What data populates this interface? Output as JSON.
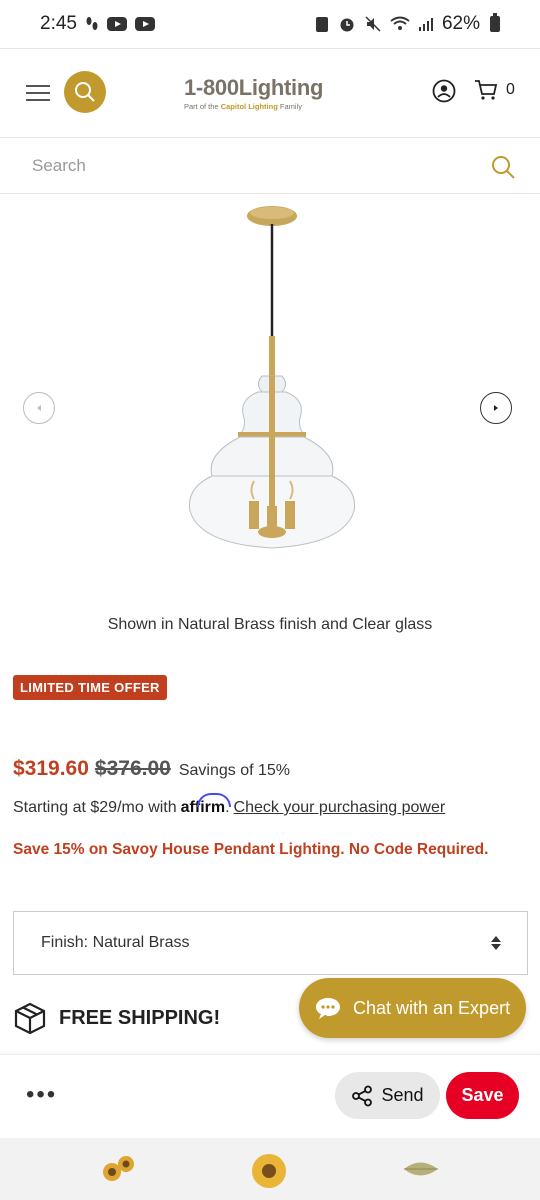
{
  "status_bar": {
    "time": "2:45",
    "battery": "62%"
  },
  "header": {
    "logo_main": "1-800Lighting",
    "logo_sub_prefix": "Part of the",
    "logo_sub_brand": "Capitol Lighting",
    "logo_sub_suffix": "Family",
    "cart_count": "0"
  },
  "search": {
    "placeholder": "Search"
  },
  "product": {
    "caption": "Shown in Natural Brass finish and Clear glass",
    "offer_badge": "LIMITED TIME OFFER",
    "price_now": "$319.60",
    "price_was": "$376.00",
    "savings": "Savings of 15%",
    "affirm_prefix": "Starting at $29/mo with",
    "affirm_brand": "affirm",
    "affirm_link": "Check your purchasing power",
    "promo": "Save 15% on Savoy House Pendant Lighting. No Code Required.",
    "finish_select": "Finish: Natural Brass",
    "shipping": "FREE SHIPPING!"
  },
  "chat": {
    "label": "Chat with an Expert"
  },
  "bottom_bar": {
    "more": "•••",
    "send_label": "Send",
    "save_label": "Save"
  },
  "icons": {
    "menu": "hamburger-icon",
    "search": "search-icon",
    "account": "account-icon",
    "cart": "cart-icon",
    "prev": "chevron-left-icon",
    "next": "chevron-right-icon",
    "box": "box-icon",
    "chat": "chat-bubble-icon",
    "share": "share-icon"
  },
  "colors": {
    "brand_gold": "#c19a2e",
    "accent_red": "#c13f1e",
    "save_red": "#e60023"
  }
}
